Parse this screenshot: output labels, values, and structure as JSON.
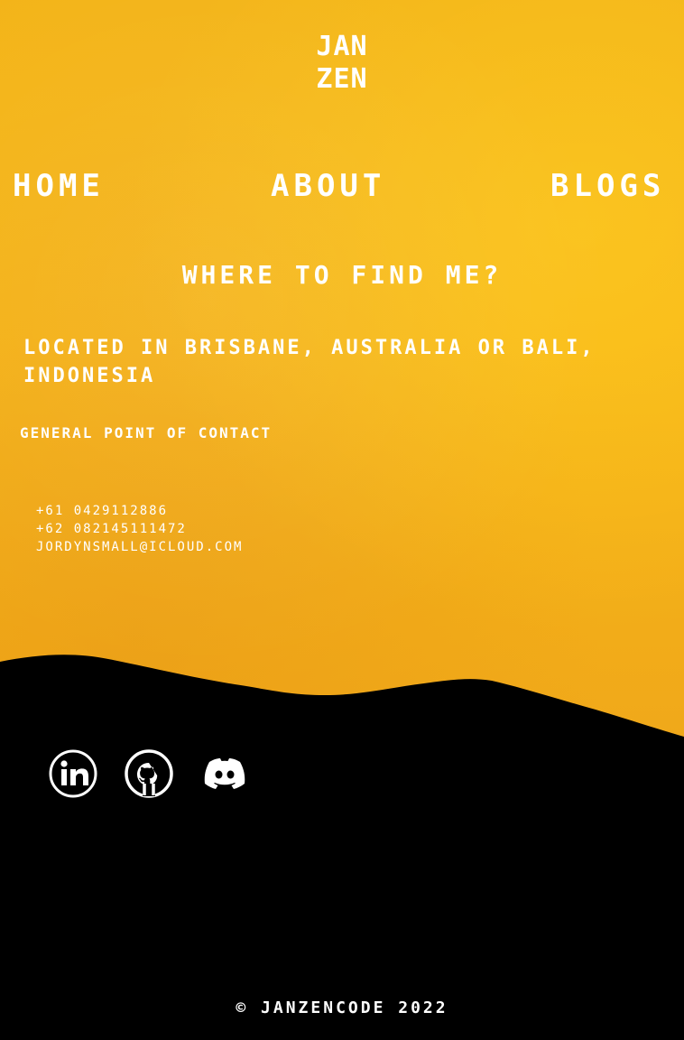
{
  "logo": {
    "line1": "JAN",
    "line2": "ZEN"
  },
  "nav": {
    "home": "HOME",
    "about": "ABOUT",
    "blogs": "BLOGS"
  },
  "main": {
    "heading": "WHERE TO FIND ME?",
    "location": "LOCATED IN BRISBANE, AUSTRALIA OR BALI, INDONESIA",
    "contact_heading": "GENERAL POINT OF CONTACT",
    "contacts": {
      "phone_au": "+61 0429112886",
      "phone_id": "+62 082145111472",
      "email": "JORDYNSMALL@ICLOUD.COM"
    }
  },
  "social": [
    {
      "name": "linkedin",
      "icon": "linkedin-icon"
    },
    {
      "name": "github",
      "icon": "github-icon"
    },
    {
      "name": "discord",
      "icon": "discord-icon"
    }
  ],
  "footer": {
    "copyright": "© JANZENCODE 2022"
  },
  "colors": {
    "background_orange": "#f7b616",
    "foreground_text": "#ffffff",
    "hills_black": "#000000"
  }
}
